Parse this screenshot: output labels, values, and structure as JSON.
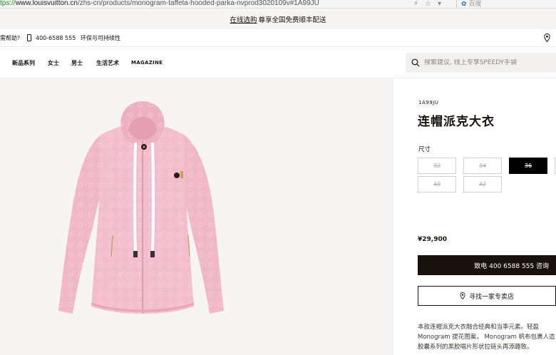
{
  "browser": {
    "url_scheme": "tps://",
    "url_host": "www.louisvuitton.cn",
    "url_path": "/zhs-cn/products/monogram-taffeta-hooded-parka-nvprod3020109v#1A99JU",
    "search_engine": "百度"
  },
  "announcement": {
    "link": "在线选购",
    "text": "尊享全国免费顺丰配送"
  },
  "utility": {
    "help": "需帮助?",
    "phone": "400-6588 555",
    "sustainability": "环保与可持续性"
  },
  "nav": {
    "items": [
      "新品系列",
      "女士",
      "男士",
      "生活艺术",
      "MAGAZINE"
    ],
    "search_placeholder": "搜索建议, 线上专享SPEEDY手袋"
  },
  "product": {
    "sku": "1A99JU",
    "title": "连帽派克大衣",
    "size_label": "尺寸",
    "sizes": [
      {
        "label": "32",
        "available": false
      },
      {
        "label": "34",
        "available": false
      },
      {
        "label": "36",
        "available": false,
        "selected": true
      },
      {
        "label": "38",
        "available": false
      },
      {
        "label": "40",
        "available": false
      },
      {
        "label": "42",
        "available": false
      }
    ],
    "price": "¥29,900",
    "call_button": "致电 400 6588 555 咨询",
    "store_button": "寻找一家专卖店",
    "description": [
      "本款连帽派克大衣融合经典和当季元素。轻盈",
      "Monogram 提花图案， Monogram 帆布包裹人造",
      "胶囊系列的黑胶唱片形状拉链头再添趣致。"
    ]
  },
  "colors": {
    "accent": "#19110b",
    "panel_bg": "#f6f5f3",
    "jacket_pink": "#f0b8c8"
  }
}
